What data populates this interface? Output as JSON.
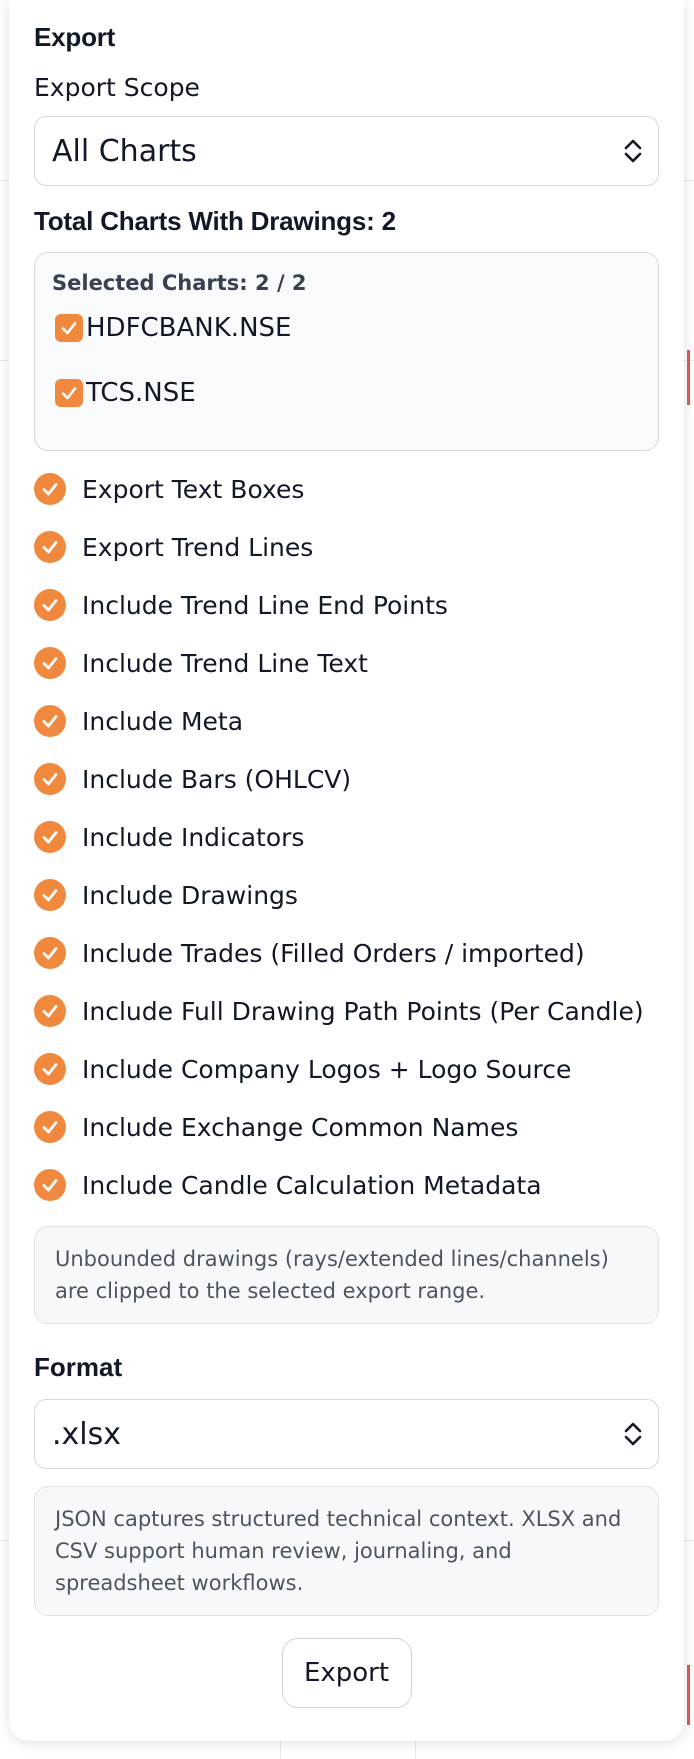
{
  "panel": {
    "title": "Export",
    "scope_label": "Export Scope",
    "scope_value": "All Charts",
    "total_label": "Total Charts With Drawings: 2",
    "selected_label": "Selected Charts: 2 / 2",
    "charts": [
      {
        "symbol": "HDFCBANK.NSE",
        "checked": true
      },
      {
        "symbol": "TCS.NSE",
        "checked": true
      }
    ],
    "options": [
      {
        "label": "Export Text Boxes",
        "checked": true
      },
      {
        "label": "Export Trend Lines",
        "checked": true
      },
      {
        "label": "Include Trend Line End Points",
        "checked": true
      },
      {
        "label": "Include Trend Line Text",
        "checked": true
      },
      {
        "label": "Include Meta",
        "checked": true
      },
      {
        "label": "Include Bars (OHLCV)",
        "checked": true
      },
      {
        "label": "Include Indicators",
        "checked": true
      },
      {
        "label": "Include Drawings",
        "checked": true
      },
      {
        "label": "Include Trades (Filled Orders / imported)",
        "checked": true
      },
      {
        "label": "Include Full Drawing Path Points (Per Candle)",
        "checked": true
      },
      {
        "label": "Include Company Logos + Logo Source",
        "checked": true
      },
      {
        "label": "Include Exchange Common Names",
        "checked": true
      },
      {
        "label": "Include Candle Calculation Metadata",
        "checked": true
      }
    ],
    "range_note": "Unbounded drawings (rays/extended lines/channels) are clipped to the selected export range.",
    "format_label": "Format",
    "format_value": ".xlsx",
    "format_note": "JSON captures structured technical context. XLSX and CSV support human review, journaling, and spreadsheet workflows.",
    "export_button": "Export"
  },
  "colors": {
    "accent": "#f0883e",
    "border": "#d5d9df",
    "note_bg": "#f7f8fa"
  },
  "icons": {
    "select_arrow": "chevron-up-down-icon",
    "checkbox": "check-icon"
  }
}
